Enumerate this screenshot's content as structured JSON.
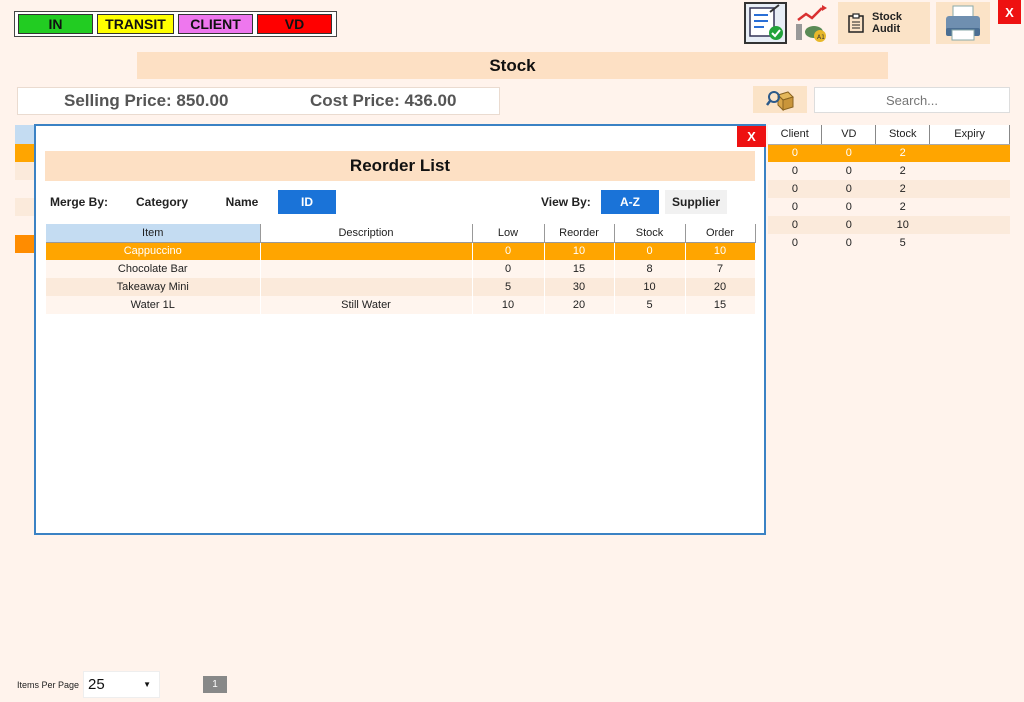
{
  "legend": {
    "items": [
      {
        "label": "IN",
        "color": "#22cc22"
      },
      {
        "label": "TRANSIT",
        "color": "#ffff00"
      },
      {
        "label": "CLIENT",
        "color": "#ee77ee"
      },
      {
        "label": "VD",
        "color": "#ff0000"
      }
    ]
  },
  "toolbar": {
    "check_icon": "checklist-edit-icon",
    "chart_icon": "sales-chart-icon",
    "audit_label_line1": "Stock",
    "audit_label_line2": "Audit",
    "print_icon": "printer-icon",
    "close_label": "X"
  },
  "page_title": "Stock",
  "prices": {
    "selling": "Selling Price: 850.00",
    "cost": "Cost Price: 436.00"
  },
  "search": {
    "placeholder": "Search..."
  },
  "background_table": {
    "headers": [
      "Client",
      "VD",
      "Stock",
      "Expiry"
    ],
    "rows": [
      [
        "0",
        "0",
        "2",
        ""
      ],
      [
        "0",
        "0",
        "2",
        ""
      ],
      [
        "0",
        "0",
        "2",
        ""
      ],
      [
        "0",
        "0",
        "2",
        ""
      ],
      [
        "0",
        "0",
        "10",
        ""
      ],
      [
        "0",
        "0",
        "5",
        ""
      ]
    ]
  },
  "modal": {
    "close_label": "X",
    "title": "Reorder List",
    "merge_label": "Merge By:",
    "merge_options": [
      "Category",
      "Name",
      "ID"
    ],
    "merge_active": "ID",
    "view_label": "View By:",
    "view_options": [
      "A-Z",
      "Supplier"
    ],
    "view_active": "A-Z",
    "headers": [
      "Item",
      "Description",
      "Low",
      "Reorder",
      "Stock",
      "Order"
    ],
    "rows": [
      [
        "Cappuccino",
        "",
        "0",
        "10",
        "0",
        "10"
      ],
      [
        "Chocolate Bar",
        "",
        "0",
        "15",
        "8",
        "7"
      ],
      [
        "Takeaway Mini",
        "",
        "5",
        "30",
        "10",
        "20"
      ],
      [
        "Water 1L",
        "Still Water",
        "10",
        "20",
        "5",
        "15"
      ]
    ]
  },
  "footer": {
    "items_per_page_label": "Items Per Page",
    "items_per_page_value": "25",
    "current_page": "1"
  }
}
